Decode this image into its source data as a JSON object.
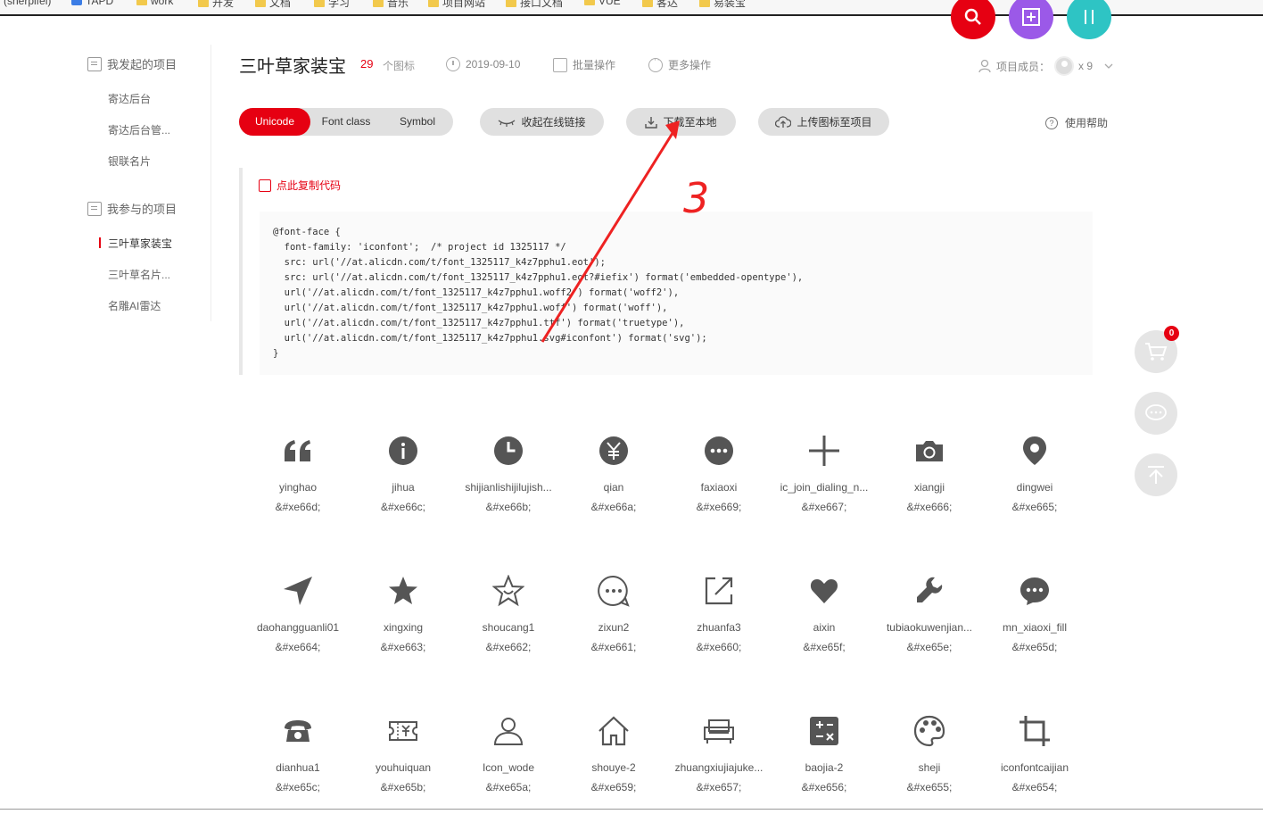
{
  "bookmarks": [
    {
      "label": "(sherpifel)",
      "icon": "none"
    },
    {
      "label": "TAPD",
      "icon": "tapd-logo"
    },
    {
      "label": "work",
      "icon": "folder-icon"
    },
    {
      "label": "开发",
      "icon": "folder-icon"
    },
    {
      "label": "文档",
      "icon": "folder-icon"
    },
    {
      "label": "学习",
      "icon": "folder-icon"
    },
    {
      "label": "音乐",
      "icon": "folder-icon"
    },
    {
      "label": "项目网站",
      "icon": "folder-icon"
    },
    {
      "label": "接口文档",
      "icon": "folder-icon"
    },
    {
      "label": "VUE",
      "icon": "folder-icon"
    },
    {
      "label": "客达",
      "icon": "folder-icon"
    },
    {
      "label": "易装宝",
      "icon": "folder-icon"
    }
  ],
  "sidebar": {
    "my_projects_heading": "我发起的项目",
    "my_projects": [
      "寄达后台",
      "寄达后台管...",
      "银联名片"
    ],
    "joined_projects_heading": "我参与的项目",
    "joined_projects": [
      "三叶草家装宝",
      "三叶草名片...",
      "名雕AI雷达"
    ]
  },
  "project": {
    "title": "三叶草家装宝",
    "icon_count": "29",
    "icon_count_label": "个图标",
    "date": "2019-09-10",
    "batch_label": "批量操作",
    "more_label": "更多操作",
    "members_label": "项目成员：",
    "members_count": "x 9"
  },
  "toolbar": {
    "tabs": [
      "Unicode",
      "Font class",
      "Symbol"
    ],
    "active_tab": "Unicode",
    "collapse_link_label": "收起在线链接",
    "download_label": "下载至本地",
    "upload_label": "上传图标至项目",
    "help_label": "使用帮助"
  },
  "code": {
    "copy_label": "点此复制代码",
    "text": "@font-face {\n  font-family: 'iconfont';  /* project id 1325117 */\n  src: url('//at.alicdn.com/t/font_1325117_k4z7pphu1.eot');\n  src: url('//at.alicdn.com/t/font_1325117_k4z7pphu1.eot?#iefix') format('embedded-opentype'),\n  url('//at.alicdn.com/t/font_1325117_k4z7pphu1.woff2') format('woff2'),\n  url('//at.alicdn.com/t/font_1325117_k4z7pphu1.woff') format('woff'),\n  url('//at.alicdn.com/t/font_1325117_k4z7pphu1.ttf') format('truetype'),\n  url('//at.alicdn.com/t/font_1325117_k4z7pphu1.svg#iconfont') format('svg');\n}"
  },
  "icons": [
    {
      "name": "yinghao",
      "code": "&#xe66d;",
      "icon": "quote-icon"
    },
    {
      "name": "jihua",
      "code": "&#xe66c;",
      "icon": "info-icon"
    },
    {
      "name": "shijianlishijilujish...",
      "code": "&#xe66b;",
      "icon": "clock-icon"
    },
    {
      "name": "qian",
      "code": "&#xe66a;",
      "icon": "yen-icon"
    },
    {
      "name": "faxiaoxi",
      "code": "&#xe669;",
      "icon": "more-dots-icon"
    },
    {
      "name": "ic_join_dialing_n...",
      "code": "&#xe667;",
      "icon": "plus-icon"
    },
    {
      "name": "xiangji",
      "code": "&#xe666;",
      "icon": "camera-icon"
    },
    {
      "name": "dingwei",
      "code": "&#xe665;",
      "icon": "location-pin-icon"
    },
    {
      "name": "daohangguanli01",
      "code": "&#xe664;",
      "icon": "navigation-arrow-icon"
    },
    {
      "name": "xingxing",
      "code": "&#xe663;",
      "icon": "star-filled-icon"
    },
    {
      "name": "shoucang1",
      "code": "&#xe662;",
      "icon": "star-outline-icon"
    },
    {
      "name": "zixun2",
      "code": "&#xe661;",
      "icon": "chat-bubble-icon"
    },
    {
      "name": "zhuanfa3",
      "code": "&#xe660;",
      "icon": "share-icon"
    },
    {
      "name": "aixin",
      "code": "&#xe65f;",
      "icon": "heart-icon"
    },
    {
      "name": "tubiaokuwenjian...",
      "code": "&#xe65e;",
      "icon": "wrench-icon"
    },
    {
      "name": "mn_xiaoxi_fill",
      "code": "&#xe65d;",
      "icon": "message-filled-icon"
    },
    {
      "name": "dianhua1",
      "code": "&#xe65c;",
      "icon": "phone-icon"
    },
    {
      "name": "youhuiquan",
      "code": "&#xe65b;",
      "icon": "coupon-icon"
    },
    {
      "name": "Icon_wode",
      "code": "&#xe65a;",
      "icon": "user-icon"
    },
    {
      "name": "shouye-2",
      "code": "&#xe659;",
      "icon": "home-icon"
    },
    {
      "name": "zhuangxiujiajuke...",
      "code": "&#xe657;",
      "icon": "sofa-icon"
    },
    {
      "name": "baojia-2",
      "code": "&#xe656;",
      "icon": "calculator-icon"
    },
    {
      "name": "sheji",
      "code": "&#xe655;",
      "icon": "palette-icon"
    },
    {
      "name": "iconfontcaijian",
      "code": "&#xe654;",
      "icon": "crop-icon"
    }
  ],
  "cart": {
    "badge_count": "0"
  },
  "annotation": {
    "text": "3",
    "color": "#ee2222"
  },
  "colors": {
    "accent": "#e60012",
    "search_btn": "#e60012",
    "add_btn": "#9b59e8",
    "exchange_btn": "#2ec4c4"
  }
}
